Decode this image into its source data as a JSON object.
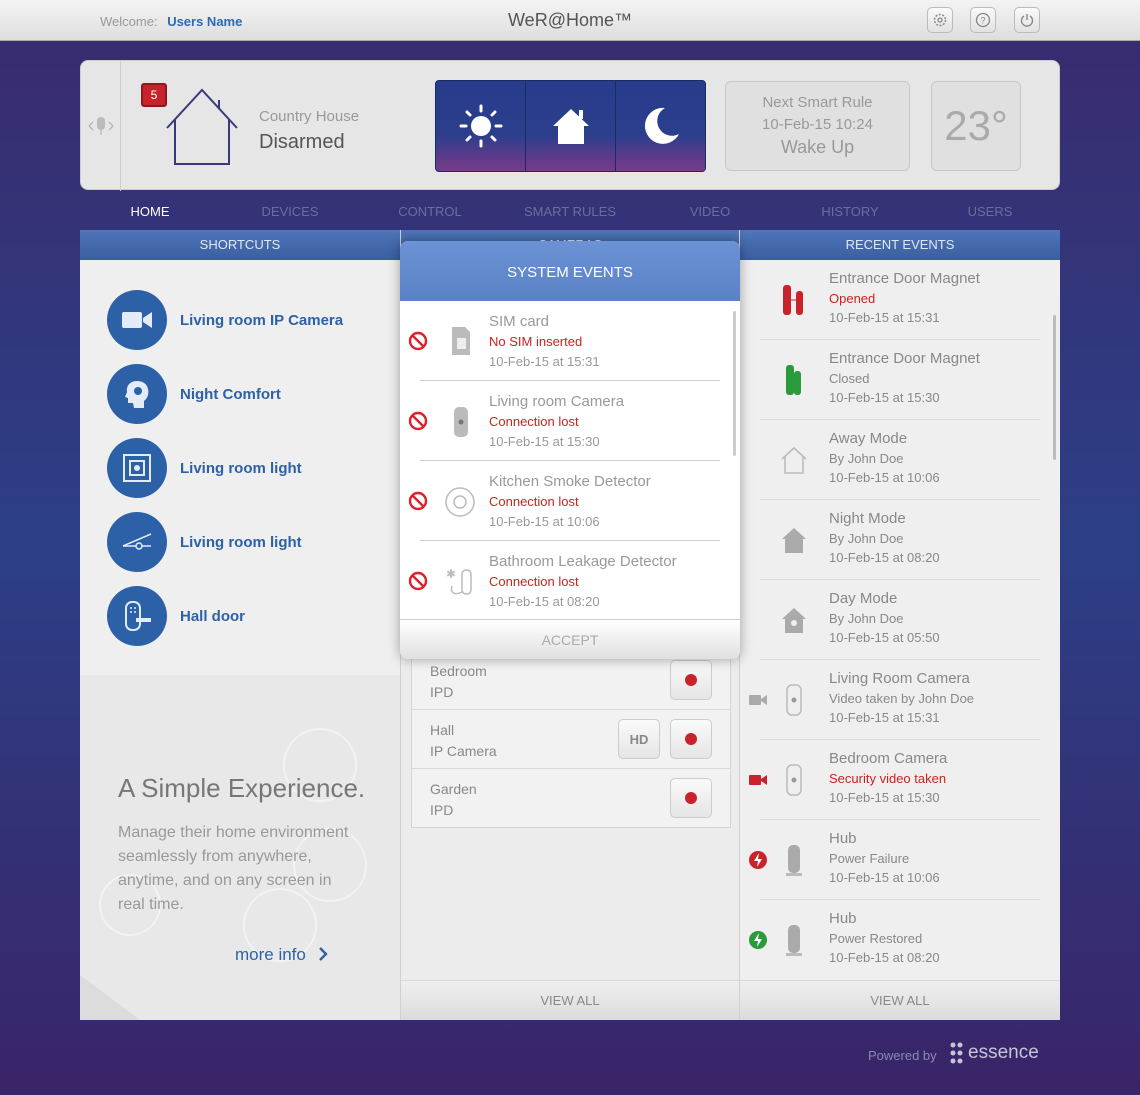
{
  "header": {
    "welcome_label": "Welcome:",
    "user_name": "Users Name",
    "brand": "WeR@Home™",
    "icons": [
      "settings-icon",
      "help-icon",
      "power-icon"
    ]
  },
  "status_panel": {
    "alert_count": "5",
    "location": "Country House",
    "state": "Disarmed",
    "modes": [
      "day-mode",
      "home-mode",
      "night-mode"
    ],
    "next_rule_label": "Next Smart Rule",
    "next_rule_time": "10-Feb-15 10:24",
    "next_rule_name": "Wake Up",
    "temperature": "23°"
  },
  "nav": {
    "tabs": [
      "HOME",
      "DEVICES",
      "CONTROL",
      "SMART RULES",
      "VIDEO",
      "HISTORY",
      "USERS"
    ],
    "active": "HOME"
  },
  "shortcuts": {
    "title": "SHORTCUTS",
    "items": [
      {
        "label": "Living room IP Camera",
        "icon": "camera-icon"
      },
      {
        "label": "Night Comfort",
        "icon": "head-icon"
      },
      {
        "label": "Living room light",
        "icon": "light-switch-icon"
      },
      {
        "label": "Living room light",
        "icon": "dimmer-icon"
      },
      {
        "label": "Hall door",
        "icon": "door-lock-icon"
      }
    ]
  },
  "promo": {
    "title": "A Simple Experience.",
    "text": "Manage their home environment seamlessly from anywhere, anytime, and on any screen in real time.",
    "link": "more info"
  },
  "cameras": {
    "title": "CAMERAS",
    "rows": [
      {
        "name": "Bedroom",
        "type": "IPD",
        "hd": false
      },
      {
        "name": "Hall",
        "type": "IP Camera",
        "hd": true,
        "hd_label": "HD"
      },
      {
        "name": "Garden",
        "type": "IPD",
        "hd": false
      }
    ],
    "view_all": "VIEW ALL"
  },
  "recent_events": {
    "title": "RECENT EVENTS",
    "view_all": "VIEW ALL",
    "items": [
      {
        "title": "Entrance Door Magnet",
        "sub": "Opened",
        "time": "10-Feb-15 at 15:31",
        "sub_red": true
      },
      {
        "title": "Entrance Door Magnet",
        "sub": "Closed",
        "time": "10-Feb-15 at 15:30",
        "sub_red": false
      },
      {
        "title": "Away Mode",
        "sub": "By John Doe",
        "time": "10-Feb-15 at 10:06",
        "sub_red": false
      },
      {
        "title": "Night Mode",
        "sub": "By John Doe",
        "time": "10-Feb-15 at 08:20",
        "sub_red": false
      },
      {
        "title": "Day Mode",
        "sub": "By John Doe",
        "time": "10-Feb-15 at 05:50",
        "sub_red": false
      },
      {
        "title": "Living Room Camera",
        "sub": "Video taken by John Doe",
        "time": "10-Feb-15 at 15:31",
        "sub_red": false
      },
      {
        "title": "Bedroom Camera",
        "sub": "Security video taken",
        "time": "10-Feb-15 at 15:30",
        "sub_red": true
      },
      {
        "title": "Hub",
        "sub": "Power Failure",
        "time": "10-Feb-15 at 10:06",
        "sub_red": false
      },
      {
        "title": "Hub",
        "sub": "Power Restored",
        "time": "10-Feb-15 at 08:20",
        "sub_red": false
      }
    ]
  },
  "modal": {
    "title": "SYSTEM EVENTS",
    "accept": "ACCEPT",
    "items": [
      {
        "title": "SIM card",
        "sub": "No SIM inserted",
        "time": "10-Feb-15 at 15:31",
        "icon": "sim-card-icon"
      },
      {
        "title": "Living room Camera",
        "sub": "Connection lost",
        "time": "10-Feb-15 at 15:30",
        "icon": "camera-device-icon"
      },
      {
        "title": "Kitchen Smoke Detector",
        "sub": "Connection lost",
        "time": "10-Feb-15 at 10:06",
        "icon": "smoke-detector-icon"
      },
      {
        "title": "Bathroom Leakage Detector",
        "sub": "Connection lost",
        "time": "10-Feb-15 at 08:20",
        "icon": "leak-detector-icon"
      }
    ]
  },
  "footer": {
    "powered": "Powered by",
    "logo": "essence"
  },
  "colors": {
    "accent": "#2c61a8",
    "alert": "#d02020",
    "header_blue": "#4e76b8"
  }
}
